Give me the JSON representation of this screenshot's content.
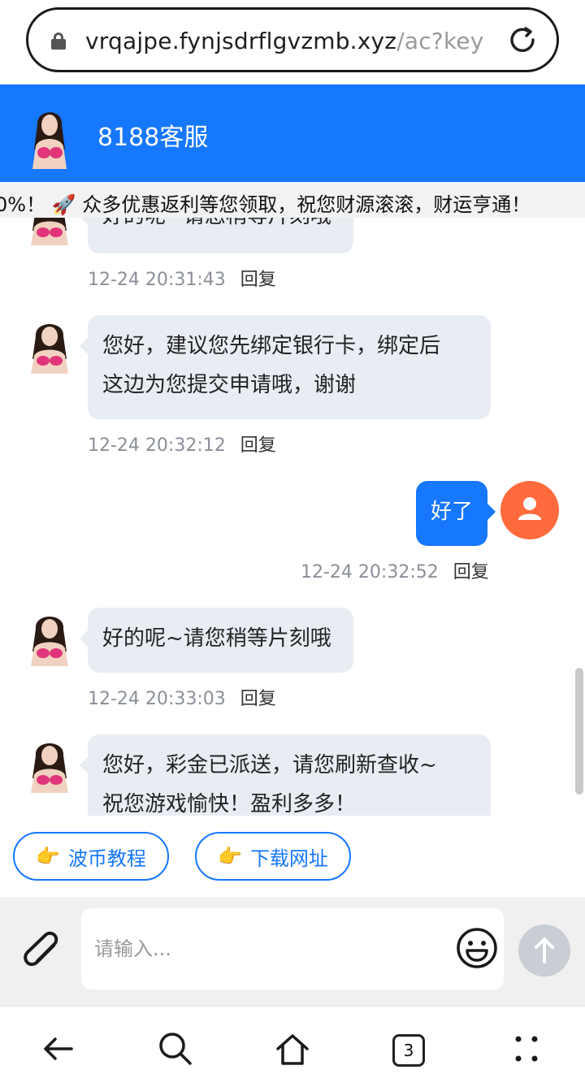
{
  "browser": {
    "url_host": "vrqajpe.fynjsdrflgvzmb.xyz",
    "url_path": "/ac?key",
    "tab_count": "3"
  },
  "header": {
    "title": "8188客服"
  },
  "marquee": {
    "text": "0%！ 🚀 众多优惠返利等您领取，祝您财源滚滚，财运亨通！"
  },
  "messages": [
    {
      "side": "left",
      "text": "好的呢~请您稍等片刻哦",
      "time": "12-24 20:31:43",
      "reply": "回复"
    },
    {
      "side": "left",
      "line1": "您好，建议您先绑定银行卡，绑定后",
      "line2": "这边为您提交申请哦，谢谢",
      "time": "12-24 20:32:12",
      "reply": "回复"
    },
    {
      "side": "right",
      "text": "好了",
      "time": "12-24 20:32:52",
      "reply": "回复"
    },
    {
      "side": "left",
      "text": "好的呢~请您稍等片刻哦",
      "time": "12-24 20:33:03",
      "reply": "回复"
    },
    {
      "side": "left",
      "line1": "您好，彩金已派送，请您刷新查收~",
      "line2": "祝您游戏愉快！盈利多多！"
    }
  ],
  "quick_buttons": [
    {
      "icon": "pointing-hand-icon",
      "label": "波币教程"
    },
    {
      "icon": "pointing-hand-icon",
      "label": "下载网址"
    }
  ],
  "input": {
    "placeholder": "请输入..."
  },
  "colors": {
    "accent": "#1677ff",
    "user_avatar": "#ff6b3d",
    "bubble": "#e8ecf3"
  }
}
